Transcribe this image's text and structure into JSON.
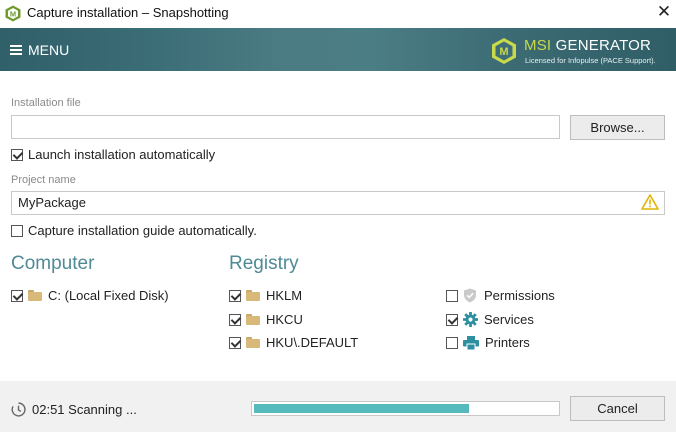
{
  "window": {
    "title": "Capture installation – Snapshotting",
    "close_glyph": "✕"
  },
  "header": {
    "menu_label": "MENU",
    "brand_prefix": "MSI",
    "brand_suffix": " GENERATOR",
    "brand_license": "Licensed for Infopulse (PACE Support).",
    "brand_logo_letter": "M",
    "brand_color": "#c8d94a"
  },
  "installation_file": {
    "label": "Installation file",
    "value": "",
    "browse_label": "Browse..."
  },
  "launch_auto": {
    "label": "Launch installation automatically",
    "checked": true
  },
  "project_name": {
    "label": "Project name",
    "value": "MyPackage",
    "warning_icon": "warning-icon"
  },
  "capture_guide": {
    "label": "Capture installation guide automatically.",
    "checked": false
  },
  "computer": {
    "title": "Computer",
    "items": [
      {
        "label": "C: (Local Fixed Disk)",
        "checked": true
      }
    ]
  },
  "registry": {
    "title": "Registry",
    "items": [
      {
        "label": "HKLM",
        "checked": true
      },
      {
        "label": "HKCU",
        "checked": true
      },
      {
        "label": "HKU\\.DEFAULT",
        "checked": true
      }
    ]
  },
  "extras": {
    "items": [
      {
        "label": "Permissions",
        "checked": false,
        "icon": "shield-icon"
      },
      {
        "label": "Services",
        "checked": true,
        "icon": "gear-icon"
      },
      {
        "label": "Printers",
        "checked": false,
        "icon": "printer-icon"
      }
    ]
  },
  "footer": {
    "status": "02:51 Scanning  ...",
    "progress": 0.71,
    "cancel_label": "Cancel",
    "accent": "#56b9bc"
  }
}
